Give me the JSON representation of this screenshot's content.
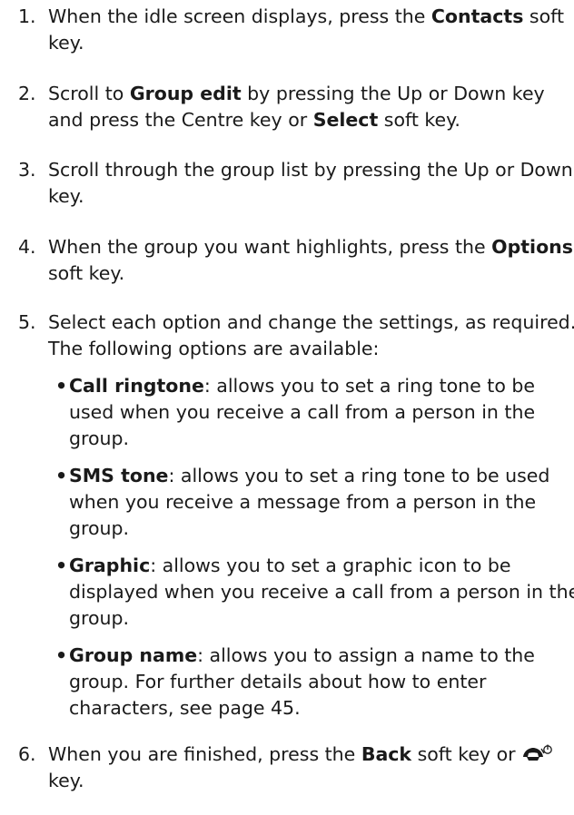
{
  "steps": [
    {
      "num": "1.",
      "parts": [
        "When the idle screen displays, press the ",
        "Contacts",
        " soft key."
      ]
    },
    {
      "num": "2.",
      "parts": [
        "Scroll to ",
        "Group edit",
        " by pressing the Up or Down key and press the Centre key or ",
        "Select",
        " soft key."
      ]
    },
    {
      "num": "3.",
      "parts": [
        "Scroll through the group list by pressing the Up or Down key."
      ]
    },
    {
      "num": "4.",
      "parts": [
        "When the group you want highlights, press the ",
        "Options",
        " soft key."
      ]
    },
    {
      "num": "5.",
      "parts": [
        "Select each option and change the settings, as required. The following options are available:"
      ]
    },
    {
      "num": "6.",
      "parts": [
        "When you are finished, press the ",
        "Back",
        " soft key or ",
        "",
        " key."
      ]
    }
  ],
  "options": [
    {
      "bullet": "•",
      "term": "Call ringtone",
      "desc": ": allows you to set a ring tone to be used when you receive a call from a person in the group."
    },
    {
      "bullet": "•",
      "term": "SMS tone",
      "desc": ": allows you to set a ring tone to be used when you receive a message from a person in the group."
    },
    {
      "bullet": "•",
      "term": "Graphic",
      "desc": ": allows you to set a graphic icon to be displayed when you receive a call from a person in the group."
    },
    {
      "bullet": "•",
      "term": "Group name",
      "desc": ": allows you to assign a name to the group. For further details about how to enter characters, see page 45."
    }
  ],
  "icons": {
    "end_key": "end-power-key-icon"
  }
}
